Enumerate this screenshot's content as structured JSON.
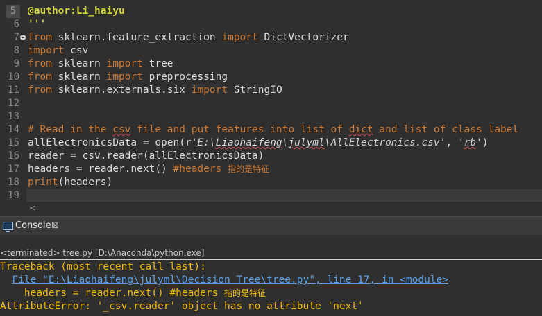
{
  "editor": {
    "lines": [
      {
        "num": "5",
        "parts": [
          {
            "t": "@author:Li_haiyu",
            "c": "deco"
          }
        ]
      },
      {
        "num": "6",
        "parts": [
          {
            "t": "'''",
            "c": "deco"
          }
        ]
      },
      {
        "num": "7",
        "fold": true,
        "parts": [
          {
            "t": "from",
            "c": "kw"
          },
          {
            "t": " sklearn.feature_extraction ",
            "c": ""
          },
          {
            "t": "import",
            "c": "kw"
          },
          {
            "t": " DictVectorizer",
            "c": ""
          }
        ]
      },
      {
        "num": "8",
        "parts": [
          {
            "t": "import",
            "c": "kw"
          },
          {
            "t": " csv",
            "c": ""
          }
        ]
      },
      {
        "num": "9",
        "parts": [
          {
            "t": "from",
            "c": "kw"
          },
          {
            "t": " sklearn ",
            "c": ""
          },
          {
            "t": "import",
            "c": "kw"
          },
          {
            "t": " tree",
            "c": ""
          }
        ]
      },
      {
        "num": "10",
        "parts": [
          {
            "t": "from",
            "c": "kw"
          },
          {
            "t": " sklearn ",
            "c": ""
          },
          {
            "t": "import",
            "c": "kw"
          },
          {
            "t": " preprocessing",
            "c": ""
          }
        ]
      },
      {
        "num": "11",
        "parts": [
          {
            "t": "from",
            "c": "kw"
          },
          {
            "t": " sklearn.externals.six ",
            "c": ""
          },
          {
            "t": "import",
            "c": "kw"
          },
          {
            "t": " StringIO",
            "c": ""
          }
        ]
      },
      {
        "num": "12",
        "parts": []
      },
      {
        "num": "13",
        "parts": []
      },
      {
        "num": "14",
        "parts": [
          {
            "t": "# Read in the ",
            "c": "cm"
          },
          {
            "t": "csv",
            "c": "cm wavy"
          },
          {
            "t": " file and put features into list of ",
            "c": "cm"
          },
          {
            "t": "dict",
            "c": "cm wavy"
          },
          {
            "t": " and list of class label",
            "c": "cm"
          }
        ]
      },
      {
        "num": "15",
        "parts": [
          {
            "t": "allElectronicsData = open(r",
            "c": ""
          },
          {
            "t": "'E:\\",
            "c": "str"
          },
          {
            "t": "Liaohaifeng",
            "c": "str wavy"
          },
          {
            "t": "\\",
            "c": "str"
          },
          {
            "t": "julyml",
            "c": "str wavy"
          },
          {
            "t": "\\AllElectronics.csv'",
            "c": "str"
          },
          {
            "t": ", ",
            "c": ""
          },
          {
            "t": "'",
            "c": "str"
          },
          {
            "t": "rb",
            "c": "str wavy"
          },
          {
            "t": "'",
            "c": "str"
          },
          {
            "t": ")",
            "c": ""
          }
        ]
      },
      {
        "num": "16",
        "parts": [
          {
            "t": "reader = csv.reader(allElectronicsData)",
            "c": ""
          }
        ]
      },
      {
        "num": "17",
        "parts": [
          {
            "t": "headers = reader.next() ",
            "c": ""
          },
          {
            "t": "#headers ",
            "c": "cm"
          },
          {
            "t": "指的是特征",
            "c": "cm zh"
          }
        ]
      },
      {
        "num": "18",
        "parts": [
          {
            "t": "print",
            "c": "kw"
          },
          {
            "t": "(headers)",
            "c": ""
          }
        ]
      },
      {
        "num": "19",
        "parts": []
      }
    ]
  },
  "console": {
    "tab_label": "Console",
    "close_glyph": "⊠",
    "terminated": "<terminated> tree.py [D:\\Anaconda\\python.exe]",
    "output": [
      {
        "parts": [
          {
            "t": "Traceback (most recent call last):",
            "c": "err"
          }
        ]
      },
      {
        "parts": [
          {
            "t": "  ",
            "c": "err"
          },
          {
            "t": "File \"E:\\Liaohaifeng\\julyml\\Decision Tree\\tree.py\", line 17, in <module>",
            "c": "link"
          }
        ]
      },
      {
        "parts": [
          {
            "t": "    headers = reader.next() #headers ",
            "c": "err"
          },
          {
            "t": "指的是特征",
            "c": "err zh"
          }
        ]
      },
      {
        "parts": [
          {
            "t": "AttributeError: '_csv.reader' object has no attribute 'next'",
            "c": "err"
          }
        ]
      }
    ]
  }
}
